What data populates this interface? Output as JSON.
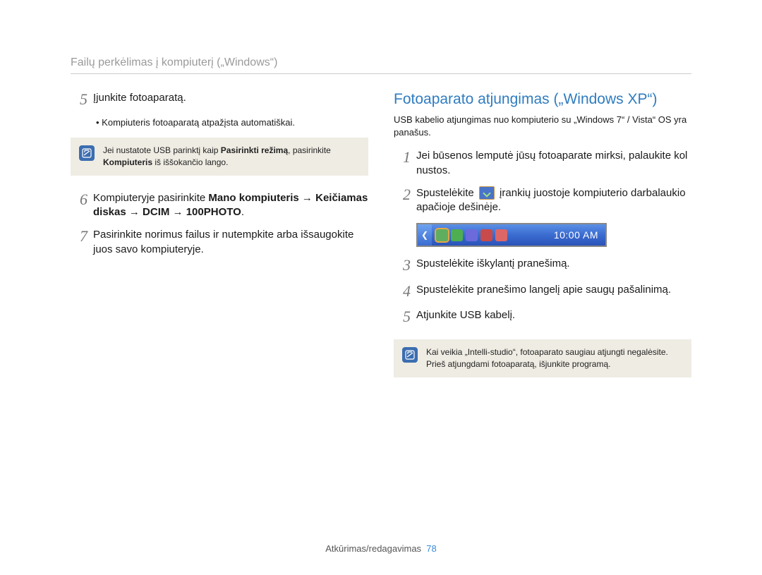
{
  "header": {
    "title": "Failų perkėlimas į kompiuterį („Windows“)"
  },
  "left": {
    "step5": {
      "num": "5",
      "text": "Įjunkite fotoaparatą.",
      "bullet": "Kompiuteris fotoaparatą atpažįsta automatiškai."
    },
    "note1": {
      "t1": "Jei nustatote USB parinktį kaip ",
      "b1": "Pasirinkti režimą",
      "t2": ", pasirinkite ",
      "b2": "Kompiuteris",
      "t3": " iš iššokančio lango."
    },
    "step6": {
      "num": "6",
      "t1": "Kompiuteryje pasirinkite ",
      "b1": "Mano kompiuteris",
      "arrow": " → ",
      "b2": "Keičiamas diskas",
      "b3": "DCIM",
      "b4": "100PHOTO",
      "dot": "."
    },
    "step7": {
      "num": "7",
      "text": "Pasirinkite norimus failus ir nutempkite arba išsaugokite juos savo kompiuteryje."
    }
  },
  "right": {
    "heading": "Fotoaparato atjungimas („Windows XP“)",
    "sub": "USB kabelio atjungimas nuo kompiuterio su „Windows 7“ / Vista“ OS yra panašus.",
    "step1": {
      "num": "1",
      "text": "Jei būsenos lemputė jūsų fotoaparate mirksi, palaukite kol nustos."
    },
    "step2": {
      "num": "2",
      "t1": "Spustelėkite ",
      "t2": " įrankių juostoje kompiuterio darbalaukio apačioje dešinėje."
    },
    "taskbar": {
      "clock": "10:00 AM"
    },
    "step3": {
      "num": "3",
      "text": "Spustelėkite iškylantį pranešimą."
    },
    "step4": {
      "num": "4",
      "text": "Spustelėkite pranešimo langelį apie saugų pašalinimą."
    },
    "step5": {
      "num": "5",
      "text": "Atjunkite USB kabelį."
    },
    "note2": {
      "line1": "Kai veikia „Intelli-studio“, fotoaparato saugiau atjungti negalėsite.",
      "line2": "Prieš atjungdami fotoaparatą, išjunkite programą."
    }
  },
  "footer": {
    "section": "Atkūrimas/redagavimas",
    "page": "78"
  }
}
